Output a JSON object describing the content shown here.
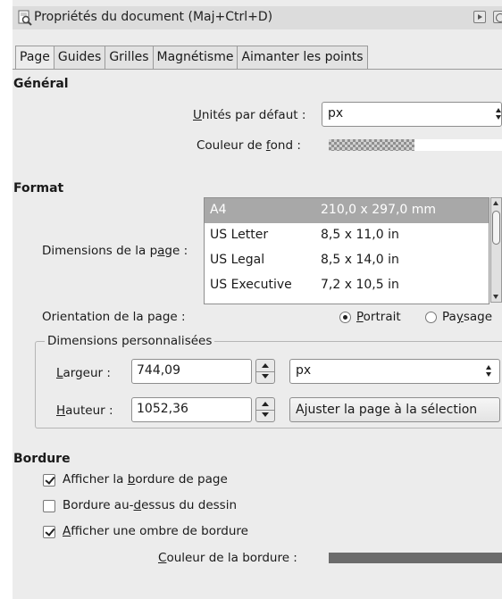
{
  "window": {
    "title": "Propriétés du document (Maj+Ctrl+D)"
  },
  "tabs": [
    "Page",
    "Guides",
    "Grilles",
    "Magnétisme",
    "Aimanter les points"
  ],
  "general": {
    "heading": "Général",
    "units_label_u": "U",
    "units_label_rest": "nités par défaut :",
    "units_value": "px",
    "bg_color_label_pre": "Couleur de ",
    "bg_color_label_u": "f",
    "bg_color_label_post": "ond :"
  },
  "format": {
    "heading": "Format",
    "page_size_label_pre": "Dimensions de la p",
    "page_size_label_u": "a",
    "page_size_label_post": "ge :",
    "page_sizes": [
      {
        "name": "A4",
        "size": "210,0 x 297,0 mm"
      },
      {
        "name": "US Letter",
        "size": "8,5 x 11,0 in"
      },
      {
        "name": "US Legal",
        "size": "8,5 x 14,0 in"
      },
      {
        "name": "US Executive",
        "size": "7,2 x 10,5 in"
      }
    ],
    "orientation_label": "Orientation de la page :",
    "portrait_u": "P",
    "portrait_rest": "ortrait",
    "landscape_pre": "Pa",
    "landscape_u": "y",
    "landscape_post": "sage",
    "orientation_selected": "Portrait"
  },
  "custom_size": {
    "heading": "Dimensions personnalisées",
    "width_label_u": "L",
    "width_label_rest": "argeur :",
    "width_value": "744,09",
    "height_label_u": "H",
    "height_label_rest": "auteur :",
    "height_value": "1052,36",
    "units_value": "px",
    "fit_button_pre": "A",
    "fit_button_u": "j",
    "fit_button_post": "uster la page à la sélection"
  },
  "border": {
    "heading": "Bordure",
    "show_border_pre": "Afficher la ",
    "show_border_u": "b",
    "show_border_post": "ordure de page",
    "show_border_checked": true,
    "border_on_top_pre": "Bordure au-",
    "border_on_top_u": "d",
    "border_on_top_post": "essus du dessin",
    "border_on_top_checked": false,
    "show_shadow_u": "A",
    "show_shadow_rest": "fficher une ombre de bordure",
    "show_shadow_checked": true,
    "border_color_label_u": "C",
    "border_color_label_rest": "ouleur de la bordure :",
    "border_color": "#6b6b6b"
  }
}
